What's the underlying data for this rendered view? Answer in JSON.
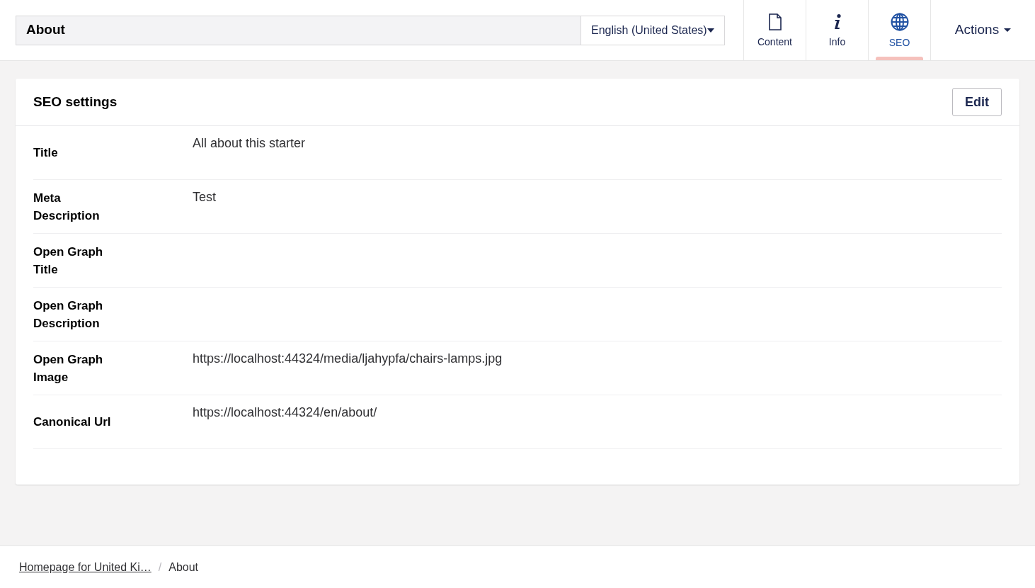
{
  "header": {
    "name": "About",
    "language": "English (United States)",
    "tabs": [
      {
        "kind": "document",
        "label": "Content",
        "selected": false
      },
      {
        "kind": "info",
        "label": "Info",
        "selected": false
      },
      {
        "kind": "globe",
        "label": "SEO",
        "selected": true
      }
    ],
    "actions": "Actions"
  },
  "panel": {
    "title": "SEO settings",
    "edit_button": "Edit",
    "fields": [
      {
        "label": "Title",
        "value": "All about this starter"
      },
      {
        "label": "Meta Description",
        "value": "Test"
      },
      {
        "label": "Open Graph Title"
      },
      {
        "label": "Open Graph Description"
      },
      {
        "label": "Open Graph Image",
        "value": "https://localhost:44324/media/ljahypfa/chairs-lamps.jpg"
      },
      {
        "label": "Canonical Url",
        "value": "https://localhost:44324/en/about/"
      }
    ]
  },
  "breadcrumb": {
    "items": [
      "Homepage for United Ki…",
      "About"
    ],
    "separator": "/"
  }
}
